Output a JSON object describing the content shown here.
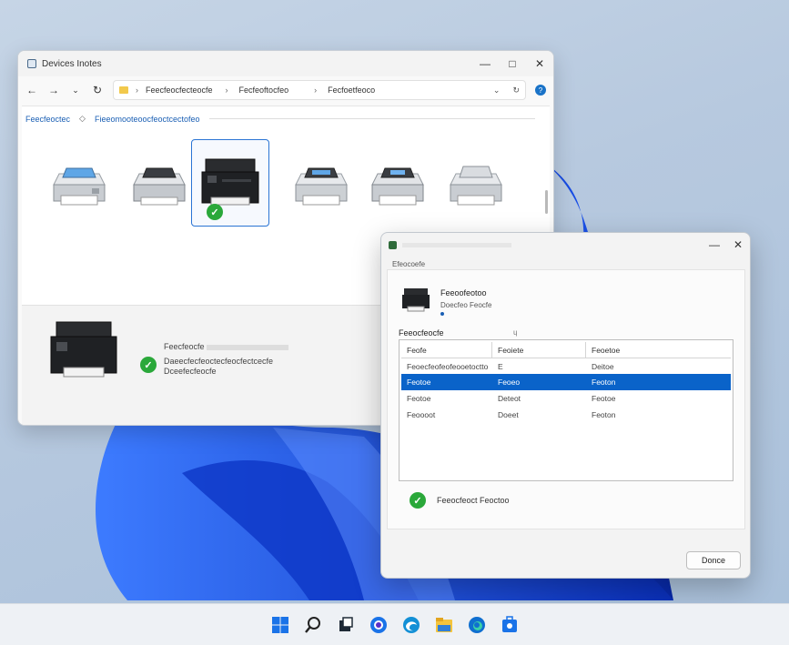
{
  "explorer": {
    "title": "Devices Inotes",
    "address": {
      "segments": [
        "Feecfeocfecteocfe",
        "Fecfeoftocfeo",
        "Fecfoetfeoco"
      ]
    },
    "breadcrumb": [
      "Feecfeoctec",
      "Fieeomooteoocfeoctcectofeo"
    ],
    "printers": [
      {
        "name": "printer-1",
        "kind": "inkjet",
        "selected": false
      },
      {
        "name": "printer-2",
        "kind": "inkjet",
        "selected": false
      },
      {
        "name": "printer-3",
        "kind": "laser-mfp",
        "selected": true
      },
      {
        "name": "printer-4",
        "kind": "inkjet",
        "selected": false
      },
      {
        "name": "printer-5",
        "kind": "inkjet",
        "selected": false
      },
      {
        "name": "printer-6",
        "kind": "inkjet",
        "selected": false
      }
    ],
    "details": {
      "name": "Feecfeocfe",
      "status_line1": "Daeecfecfeoctecfeocfectcecfe",
      "status_line2": "Dceefecfeocfe"
    }
  },
  "dialog": {
    "subhead": "Efeocoefe",
    "printer_name": "Feeoofeotoo",
    "printer_desc": "Doecfeo Feocfe",
    "list_label": "Feeocfeocfe",
    "list_label_mark": "ɥ",
    "columns": [
      "Feofe",
      "Feoiete",
      "Feoetoe"
    ],
    "rows": [
      [
        "Feoecfeofeofeooetoctto",
        "E",
        "Deitoe"
      ],
      [
        "Feotoe",
        "Feoeo",
        "Feoton"
      ],
      [
        "Feotoe",
        "Deteot",
        "Feotoe"
      ],
      [
        "Feoooot",
        "Doeet",
        "Feoton"
      ]
    ],
    "selected_row": 1,
    "status": "Feeocfeoct Feoctoo",
    "done_label": "Donce"
  },
  "taskbar": {
    "items": [
      "start",
      "search",
      "task-view",
      "chat",
      "edge-dev",
      "file-explorer",
      "edge",
      "store"
    ]
  },
  "colors": {
    "accent": "#0a63c9",
    "success": "#2aa83a"
  }
}
